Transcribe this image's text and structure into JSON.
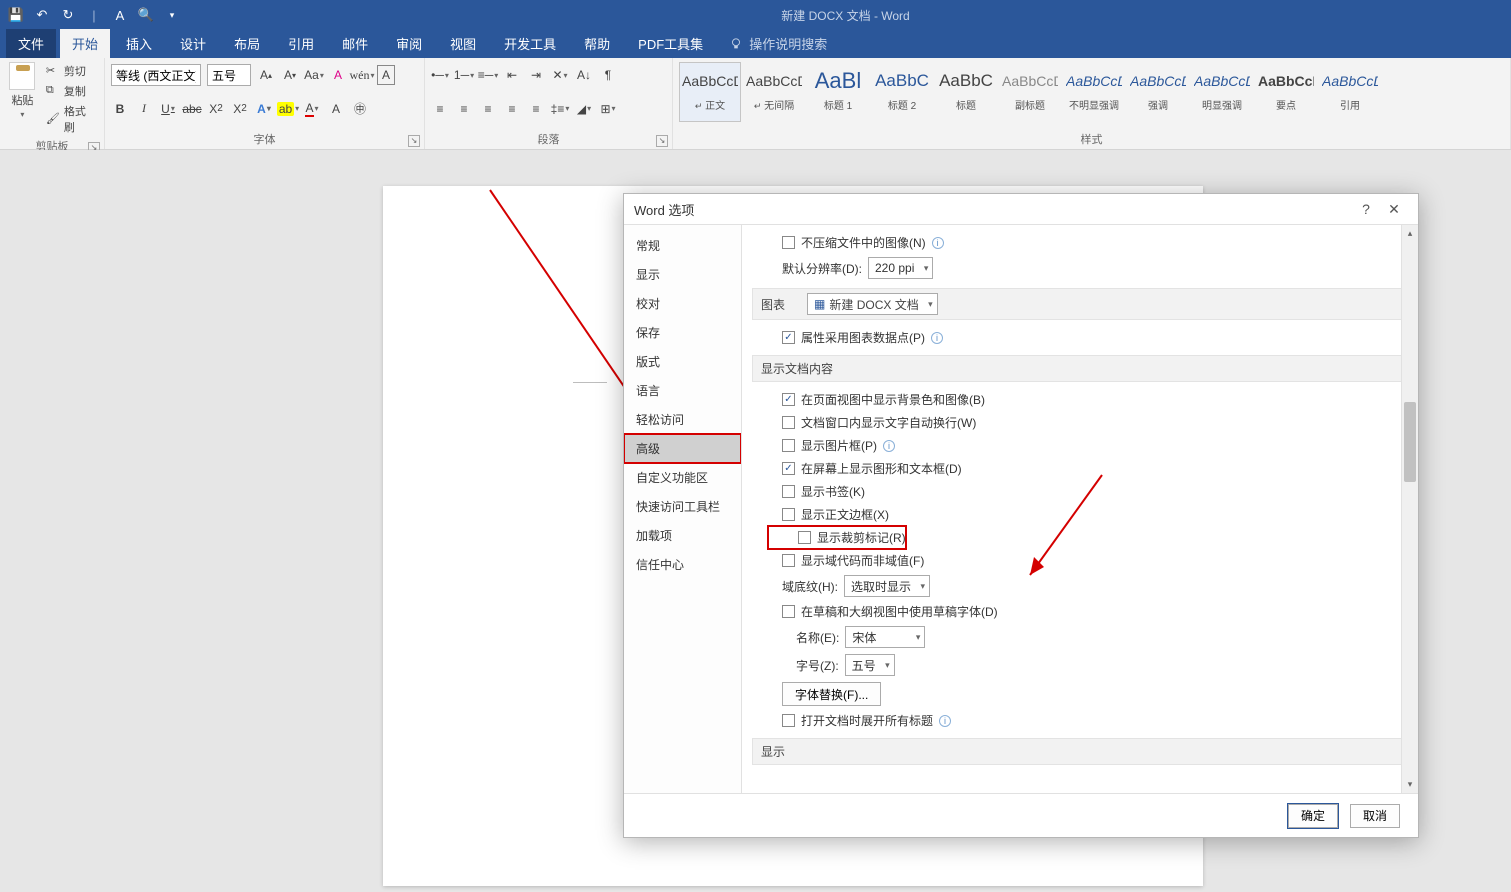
{
  "app": {
    "title": "新建 DOCX 文档  -  Word"
  },
  "qat": {
    "save": "💾",
    "undo": "↶",
    "redo": "↻"
  },
  "tabs": {
    "file": "文件",
    "home": "开始",
    "insert": "插入",
    "design": "设计",
    "layout": "布局",
    "references": "引用",
    "mailings": "邮件",
    "review": "审阅",
    "view": "视图",
    "developer": "开发工具",
    "help": "帮助",
    "pdf": "PDF工具集",
    "tell": "操作说明搜索"
  },
  "ribbon": {
    "clipboard": {
      "label": "剪贴板",
      "paste": "粘贴",
      "cut": "剪切",
      "copy": "复制",
      "painter": "格式刷"
    },
    "font": {
      "label": "字体",
      "name": "等线 (西文正文)",
      "size": "五号"
    },
    "paragraph": {
      "label": "段落"
    },
    "styles": {
      "label": "样式",
      "items": [
        {
          "name": "正文",
          "sub": ""
        },
        {
          "name": "无间隔",
          "sub": ""
        },
        {
          "name": "标题 1",
          "sub": ""
        },
        {
          "name": "标题 2",
          "sub": ""
        },
        {
          "name": "标题",
          "sub": ""
        },
        {
          "name": "副标题",
          "sub": ""
        },
        {
          "name": "不明显强调",
          "sub": ""
        },
        {
          "name": "强调",
          "sub": ""
        },
        {
          "name": "明显强调",
          "sub": ""
        },
        {
          "name": "要点",
          "sub": ""
        },
        {
          "name": "引用",
          "sub": ""
        }
      ],
      "preview": "AaBbCcDd"
    }
  },
  "dialog": {
    "title": "Word 选项",
    "nav": [
      "常规",
      "显示",
      "校对",
      "保存",
      "版式",
      "语言",
      "轻松访问",
      "高级",
      "自定义功能区",
      "快速访问工具栏",
      "加载项",
      "信任中心"
    ],
    "nav_active_index": 7,
    "content": {
      "no_compress": "不压缩文件中的图像(N)",
      "default_res_label": "默认分辨率(D):",
      "default_res_value": "220 ppi",
      "chart_section": "图表",
      "chart_doc": "新建 DOCX 文档",
      "chart_prop": "属性采用图表数据点(P)",
      "show_section": "显示文档内容",
      "show_bg": "在页面视图中显示背景色和图像(B)",
      "wrap_win": "文档窗口内显示文字自动换行(W)",
      "pic_frame": "显示图片框(P)",
      "screen_shapes": "在屏幕上显示图形和文本框(D)",
      "bookmarks": "显示书签(K)",
      "text_border": "显示正文边框(X)",
      "crop_marks": "显示裁剪标记(R)",
      "field_codes": "显示域代码而非域值(F)",
      "field_shade_label": "域底纹(H):",
      "field_shade_value": "选取时显示",
      "draft_font": "在草稿和大纲视图中使用草稿字体(D)",
      "name_label": "名称(E):",
      "name_value": "宋体",
      "size_label": "字号(Z):",
      "size_value": "五号",
      "font_sub": "字体替换(F)...",
      "expand_headings": "打开文档时展开所有标题",
      "display_section": "显示"
    },
    "footer": {
      "ok": "确定",
      "cancel": "取消"
    }
  }
}
